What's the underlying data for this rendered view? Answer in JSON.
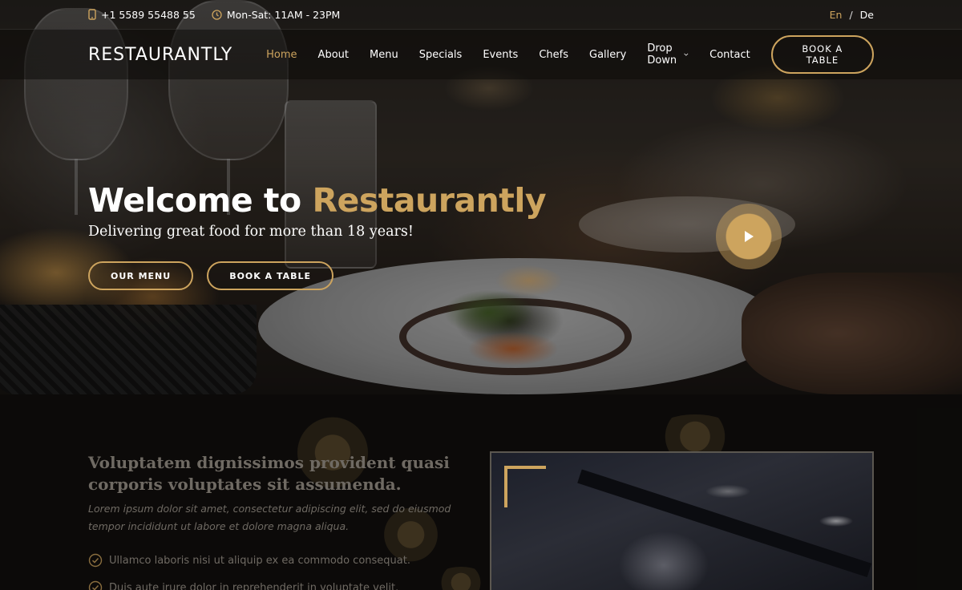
{
  "topbar": {
    "phone": "+1 5589 55488 55",
    "hours": "Mon-Sat: 11AM - 23PM",
    "lang_en": "En",
    "lang_sep": "/",
    "lang_de": "De"
  },
  "nav": {
    "logo": "RESTAURANTLY",
    "items": [
      "Home",
      "About",
      "Menu",
      "Specials",
      "Events",
      "Chefs",
      "Gallery",
      "Drop Down",
      "Contact"
    ],
    "book_label": "BOOK A TABLE"
  },
  "hero": {
    "title_part1": "Welcome to ",
    "title_part2": "Restaurantly",
    "subtitle": "Delivering great food for more than 18 years!",
    "btn_menu": "OUR MENU",
    "btn_book": "BOOK A TABLE"
  },
  "about": {
    "title": "Voluptatem dignissimos provident quasi corporis voluptates sit assumenda.",
    "lead": "Lorem ipsum dolor sit amet, consectetur adipiscing elit, sed do eiusmod tempor incididunt ut labore et dolore magna aliqua.",
    "list": [
      "Ullamco laboris nisi ut aliquip ex ea commodo consequat.",
      "Duis aute irure dolor in reprehenderit in voluptate velit."
    ]
  },
  "colors": {
    "accent": "#cda45e",
    "dark": "#0c0b09"
  },
  "icons": {
    "phone": "phone-icon",
    "clock": "clock-icon",
    "play": "play-icon",
    "check": "check-circle-icon",
    "chevron": "chevron-down-icon"
  }
}
